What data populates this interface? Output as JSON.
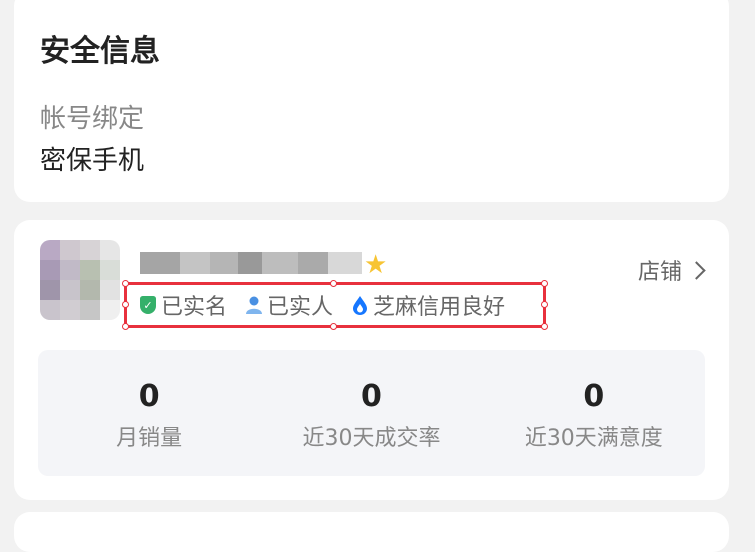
{
  "security": {
    "title": "安全信息",
    "binding_label": "帐号绑定",
    "binding_value": "密保手机"
  },
  "seller": {
    "shop_link_label": "店铺",
    "badges": [
      {
        "label": "已实名",
        "icon": "verified-shield-icon",
        "color": "#35b06a"
      },
      {
        "label": "已实人",
        "icon": "person-verified-icon",
        "color": "#4a90e2"
      },
      {
        "label": "芝麻信用良好",
        "icon": "sesame-credit-icon",
        "color": "#1677ff"
      }
    ],
    "stats": [
      {
        "value": "0",
        "label": "月销量"
      },
      {
        "value": "0",
        "label": "近30天成交率"
      },
      {
        "value": "0",
        "label": "近30天满意度"
      }
    ]
  },
  "colors": {
    "selection_outline": "#e8313d",
    "star": "#f7c433"
  }
}
